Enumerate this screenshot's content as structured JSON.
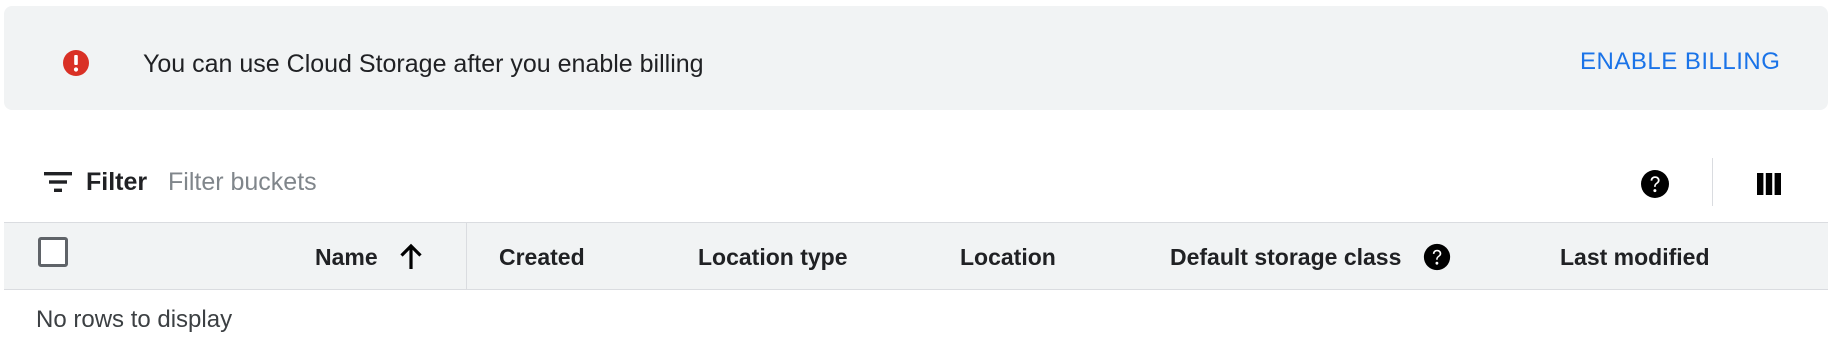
{
  "banner": {
    "icon": "error-icon",
    "message": "You can use Cloud Storage after you enable billing",
    "action_label": "ENABLE BILLING",
    "accent_color": "#1a73e8",
    "error_color": "#d93025"
  },
  "toolbar": {
    "filter_icon": "filter-list-icon",
    "filter_label": "Filter",
    "filter_placeholder": "Filter buckets",
    "filter_value": "",
    "help_icon": "help-icon",
    "columns_icon": "view-column-icon"
  },
  "table": {
    "columns": [
      {
        "label": "Name",
        "sort": "ascending"
      },
      {
        "label": "Created"
      },
      {
        "label": "Location type"
      },
      {
        "label": "Location"
      },
      {
        "label": "Default storage class",
        "help_icon": "help-icon"
      },
      {
        "label": "Last modified"
      }
    ],
    "rows": [],
    "empty_message": "No rows to display"
  }
}
